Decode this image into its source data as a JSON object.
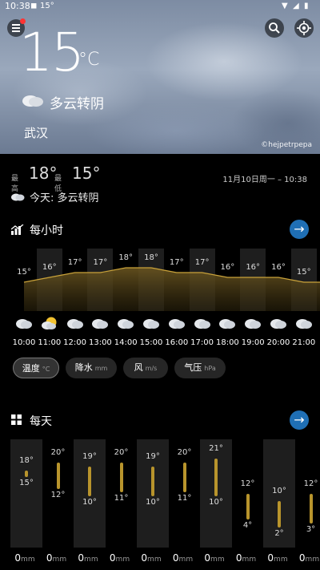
{
  "status": {
    "time": "10:38",
    "extra": "15°"
  },
  "hero": {
    "temperature": "15",
    "unit": "°C",
    "condition": "多云转阴",
    "city": "武汉",
    "photo_credit": "©hejpetrpepa"
  },
  "summary": {
    "high_label": "最高",
    "high": "18°",
    "low_label": "最低",
    "low": "15°",
    "date": "11月10日周一 – 10:38",
    "today": "今天: 多云转阴"
  },
  "hourly": {
    "title": "每小时",
    "items": [
      {
        "temp": "15°",
        "time": "10:00",
        "icon": "cloud-icon"
      },
      {
        "temp": "16°",
        "time": "11:00",
        "icon": "sun-cloud-icon"
      },
      {
        "temp": "17°",
        "time": "12:00",
        "icon": "cloud-icon"
      },
      {
        "temp": "17°",
        "time": "13:00",
        "icon": "cloud-icon"
      },
      {
        "temp": "18°",
        "time": "14:00",
        "icon": "cloud-icon"
      },
      {
        "temp": "18°",
        "time": "15:00",
        "icon": "cloud-icon"
      },
      {
        "temp": "17°",
        "time": "16:00",
        "icon": "cloud-icon"
      },
      {
        "temp": "17°",
        "time": "17:00",
        "icon": "cloud-icon"
      },
      {
        "temp": "16°",
        "time": "18:00",
        "icon": "cloud-icon"
      },
      {
        "temp": "16°",
        "time": "19:00",
        "icon": "cloud-icon"
      },
      {
        "temp": "16°",
        "time": "20:00",
        "icon": "cloud-icon"
      },
      {
        "temp": "15°",
        "time": "21:00",
        "icon": "cloud-icon"
      }
    ],
    "values": [
      15,
      16,
      17,
      17,
      18,
      18,
      17,
      17,
      16,
      16,
      16,
      15
    ]
  },
  "chips": [
    {
      "label": "温度",
      "unit": "°C",
      "active": true
    },
    {
      "label": "降水",
      "unit": "mm",
      "active": false
    },
    {
      "label": "风",
      "unit": "m/s",
      "active": false
    },
    {
      "label": "气压",
      "unit": "hPa",
      "active": false
    }
  ],
  "daily": {
    "title": "每天",
    "items": [
      {
        "high": "18°",
        "low": "15°",
        "rain": "0",
        "rain_unit": "mm"
      },
      {
        "high": "20°",
        "low": "12°",
        "rain": "0",
        "rain_unit": "mm"
      },
      {
        "high": "19°",
        "low": "10°",
        "rain": "0",
        "rain_unit": "mm"
      },
      {
        "high": "20°",
        "low": "11°",
        "rain": "0",
        "rain_unit": "mm"
      },
      {
        "high": "19°",
        "low": "10°",
        "rain": "0",
        "rain_unit": "mm"
      },
      {
        "high": "20°",
        "low": "11°",
        "rain": "0",
        "rain_unit": "mm"
      },
      {
        "high": "21°",
        "low": "10°",
        "rain": "0",
        "rain_unit": "mm"
      },
      {
        "high": "12°",
        "low": "4°",
        "rain": "0",
        "rain_unit": "mm"
      },
      {
        "high": "10°",
        "low": "2°",
        "rain": "0",
        "rain_unit": "mm"
      },
      {
        "high": "12°",
        "low": "3°",
        "rain": "0",
        "rain_unit": "mm"
      }
    ],
    "highs": [
      18,
      20,
      19,
      20,
      19,
      20,
      21,
      12,
      10,
      12
    ],
    "lows": [
      15,
      12,
      10,
      11,
      10,
      11,
      10,
      4,
      2,
      3
    ]
  },
  "colors": {
    "accent": "#1f6fb5",
    "bar": "#b8942c",
    "chart_line": "#c9a23a"
  }
}
